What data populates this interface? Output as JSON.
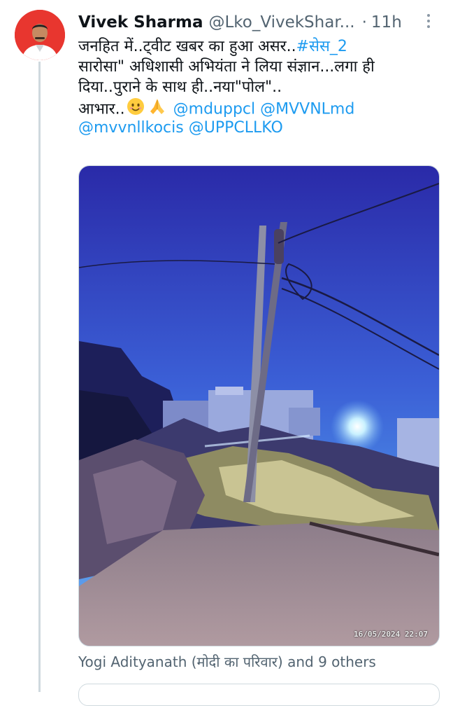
{
  "tweet": {
    "author_name": "Vivek Sharma",
    "author_handle": "@Lko_VivekShar...",
    "separator": "·",
    "time": "11h",
    "text": {
      "line1_text": "जनहित में..ट्वीट खबर का हुआ असर..",
      "line1_tag": "#सेस_2",
      "line2": "सारोसा\" अधिशासी अभियंता ने लिया संज्ञान...लगा ही",
      "line3": "दिया..पुराने के साथ ही..नया\"पोल\"..",
      "line4_text": "आभार..",
      "mention1": "@mduppcl",
      "mention2": "@MVVNLmd",
      "mention3": "@mvvnllkocis",
      "mention4": "@UPPCLLKO"
    },
    "emojis": [
      "smiling-face-emoji",
      "folded-hands-emoji"
    ],
    "media": {
      "timestamp": "16/05/2024  22:07"
    },
    "liked_by": "Yogi Adityanath (मोदी का परिवार) and 9 others"
  },
  "icons": {
    "more": "more-vertical-icon"
  },
  "colors": {
    "link": "#1d9bf0",
    "muted": "#536471",
    "text": "#0f1419",
    "border": "#cfd9de"
  }
}
